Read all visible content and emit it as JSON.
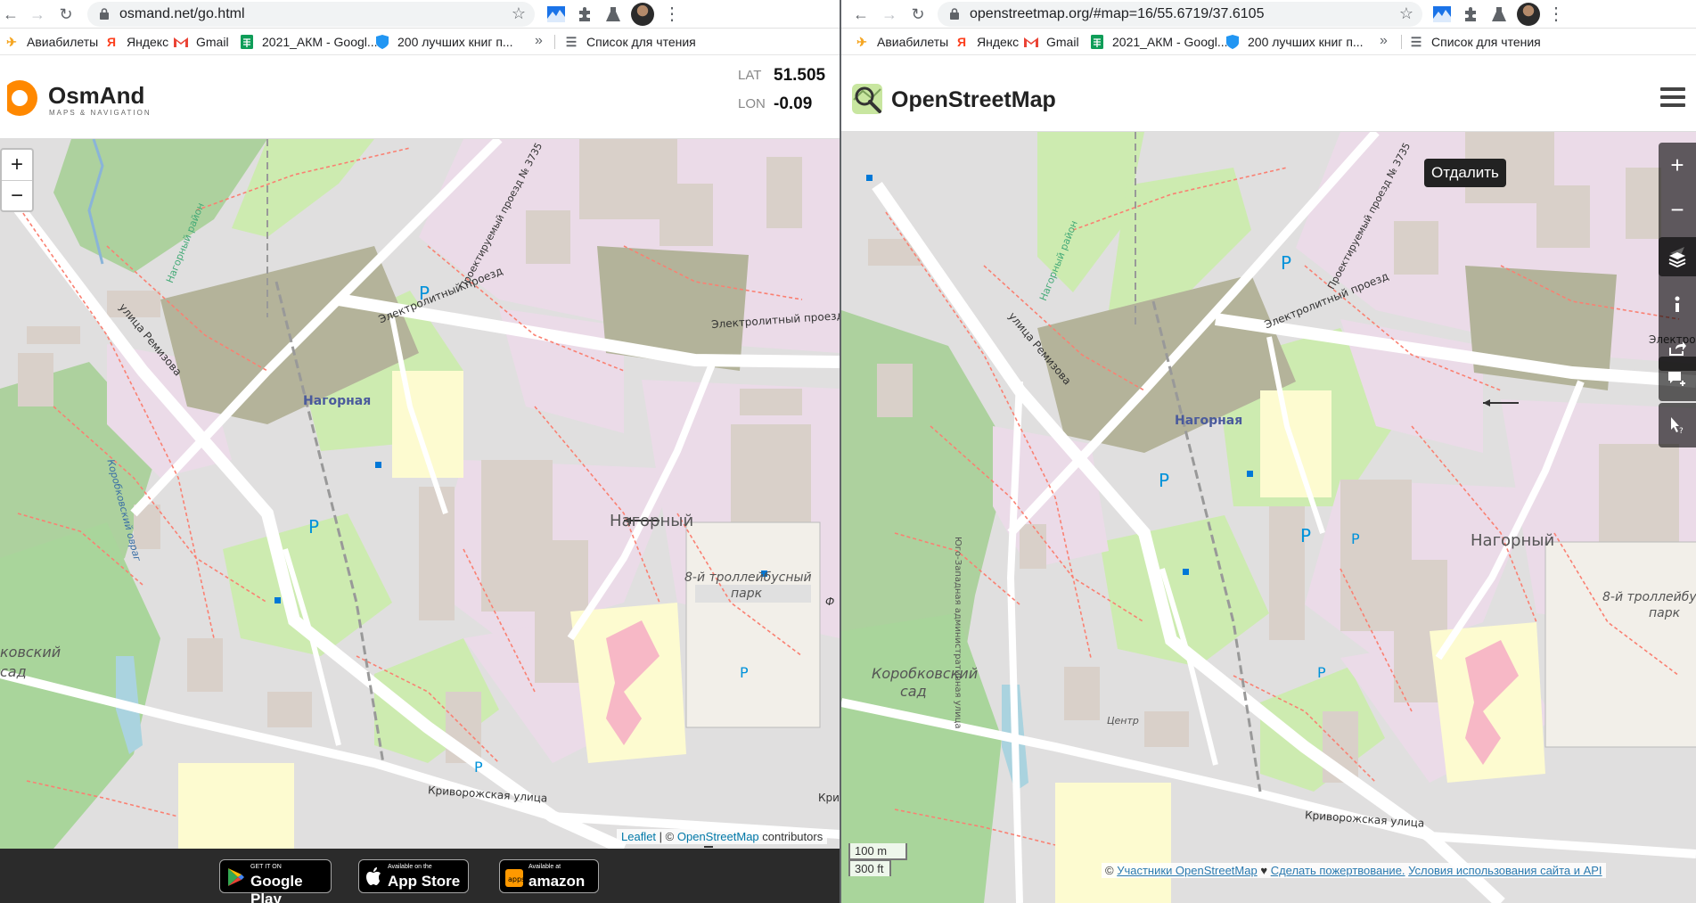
{
  "left_window": {
    "url": "osmand.net/go.html",
    "bookmarks": [
      "Авиабилеты",
      "Яндекс",
      "Gmail",
      "2021_АКМ - Googl...",
      "200 лучших книг п..."
    ],
    "bookmarks_more": "»",
    "reading_list": "Список для чтения",
    "brand": "OsmAnd",
    "brand_sub": "MAPS & NAVIGATION",
    "lat_label": "LAT",
    "lat_value": "51.505",
    "lon_label": "LON",
    "lon_value": "-0.09",
    "zoom_in": "+",
    "zoom_out": "−",
    "attribution": {
      "leaflet": "Leaflet",
      "sep": "| ©",
      "osm": "OpenStreetMap",
      "contributors": "contributors"
    },
    "store_badges": {
      "google_small": "GET IT ON",
      "google_big": "Google Play",
      "apple_small": "Available on the",
      "apple_big": "App Store",
      "amazon_small": "Available at",
      "amazon_big": "amazon"
    },
    "map_labels": {
      "street_remizova": "улица Ремизова",
      "electrolit_1": "Электролитный проезд",
      "electrolit_2": "Электролитный проезд",
      "proezd_3735": "Проектируемый проезд № 3735",
      "nagorny_rayon": "Нагорный район",
      "korobkovsky_ovrag": "Коробковский овраг",
      "station": "Нагорная",
      "trolley_1": "8-й троллейбусный",
      "trolley_2": "парк",
      "district": "Нагорный",
      "krivorozhskaya": "Криворожская улица",
      "park_1": "ковский",
      "park_2": "сад",
      "kriv_cut": "Крив",
      "f_cut": "Ф"
    }
  },
  "right_window": {
    "url": "openstreetmap.org/#map=16/55.6719/37.6105",
    "bookmarks": [
      "Авиабилеты",
      "Яндекс",
      "Gmail",
      "2021_АКМ - Googl...",
      "200 лучших книг п..."
    ],
    "bookmarks_more": "»",
    "reading_list": "Список для чтения",
    "brand": "OpenStreetMap",
    "tooltip": "Отдалить",
    "scale_metric": "100 m",
    "scale_imperial": "300 ft",
    "attribution": {
      "prefix": "©",
      "contributors": "Участники OpenStreetMap",
      "heart": "♥",
      "donate": "Сделать пожертвование.",
      "terms": "Условия использования сайта и API"
    },
    "map_labels": {
      "street_remizova": "улица Ремизова",
      "electrolit": "Электролитный проезд",
      "electrolit_cut": "Электролит",
      "proezd_3735": "Проектируемый проезд № 3735",
      "nagorny_rayon": "Нагорный район",
      "station": "Нагорная",
      "trolley_1": "8-й троллейбу",
      "trolley_2": "парк",
      "district": "Нагорный",
      "krivorozhskaya": "Криворожская улица",
      "park_1": "Коробковский",
      "park_2": "сад",
      "centre": "Центр",
      "admin_street": "Юго-Западная административная улица"
    }
  },
  "colors": {
    "residential": "#e0dfdf",
    "industrial": "#ebdbe8",
    "grass": "#cdebb0",
    "forest": "#add19e",
    "park": "#c8facc",
    "building": "#d9d0c9",
    "water": "#aad3df",
    "road": "#ffffff",
    "footway": "#fa8072",
    "school": "#ffffe5",
    "railway": "#999999"
  }
}
